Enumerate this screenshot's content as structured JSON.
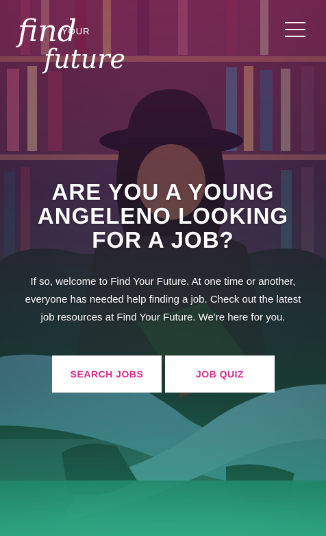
{
  "logo": {
    "find": "find",
    "your": "YOUR",
    "future": "future"
  },
  "menu": {
    "icon": "hamburger-menu-icon"
  },
  "hero": {
    "headline": "ARE YOU A YOUNG ANGELENO LOOKING FOR A JOB?",
    "intro": "If so, welcome to Find Your Future. At one time or another, everyone has needed help finding a job. Check out the latest job resources at Find Your Future. We're here for you.",
    "buttons": {
      "search": "SEARCH JOBS",
      "quiz": "JOB QUIZ"
    },
    "button_text_color": "#d52a8a"
  }
}
